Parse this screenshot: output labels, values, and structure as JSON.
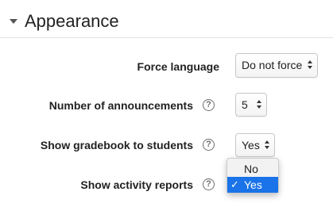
{
  "section": {
    "title": "Appearance"
  },
  "settings": [
    {
      "label": "Force language",
      "value": "Do not force"
    },
    {
      "label": "Number of announcements",
      "help": "?",
      "value": "5"
    },
    {
      "label": "Show gradebook to students",
      "help": "?",
      "value": "Yes"
    },
    {
      "label": "Show activity reports",
      "help": "?"
    }
  ],
  "dropdown": {
    "options": [
      {
        "label": "No",
        "selected": false
      },
      {
        "label": "Yes",
        "selected": true,
        "check": "✓"
      }
    ]
  },
  "colors": {
    "accent": "#1a73e8",
    "text": "#222222"
  }
}
